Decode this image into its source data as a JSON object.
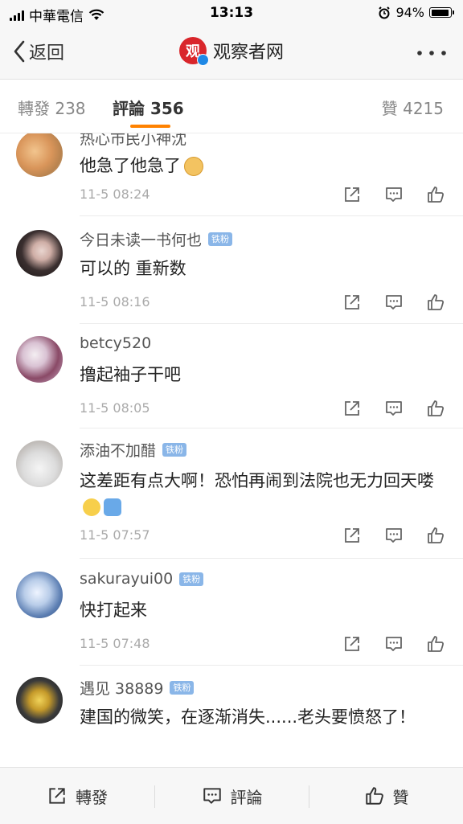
{
  "status_bar": {
    "carrier": "中華電信",
    "time": "13:13",
    "battery_text": "94%",
    "battery_level": 0.94
  },
  "nav": {
    "back_label": "返回",
    "title": "观察者网",
    "logo_char": "观"
  },
  "tabs": {
    "repost": "轉發 238",
    "comments": "評論 356",
    "likes": "贊 4215"
  },
  "comments": [
    {
      "name": "热心市民小神沈",
      "text": "他急了他急了",
      "time": "11-5 08:24",
      "badge": ""
    },
    {
      "name": "今日未读一书何也",
      "text": "可以的 重新数",
      "time": "11-5 08:16",
      "badge": "铁粉"
    },
    {
      "name": "betcy520",
      "text": "撸起袖子干吧",
      "time": "11-5 08:05",
      "badge": ""
    },
    {
      "name": "添油不加醋",
      "text": "这差距有点大啊！恐怕再闹到法院也无力回天喽",
      "time": "11-5 07:57",
      "badge": "铁粉"
    },
    {
      "name": "sakurayui00",
      "text": "快打起来",
      "time": "11-5 07:48",
      "badge": "铁粉"
    },
    {
      "name": "遇见 38889",
      "text": "建国的微笑，在逐渐消失......老头要愤怒了！",
      "time": "",
      "badge": "铁粉"
    }
  ],
  "toolbar": {
    "repost": "轉發",
    "comment": "評論",
    "like": "贊"
  },
  "colors": {
    "accent": "#ff8200",
    "badge": "#8ab6e8",
    "logo": "#d9262b"
  }
}
